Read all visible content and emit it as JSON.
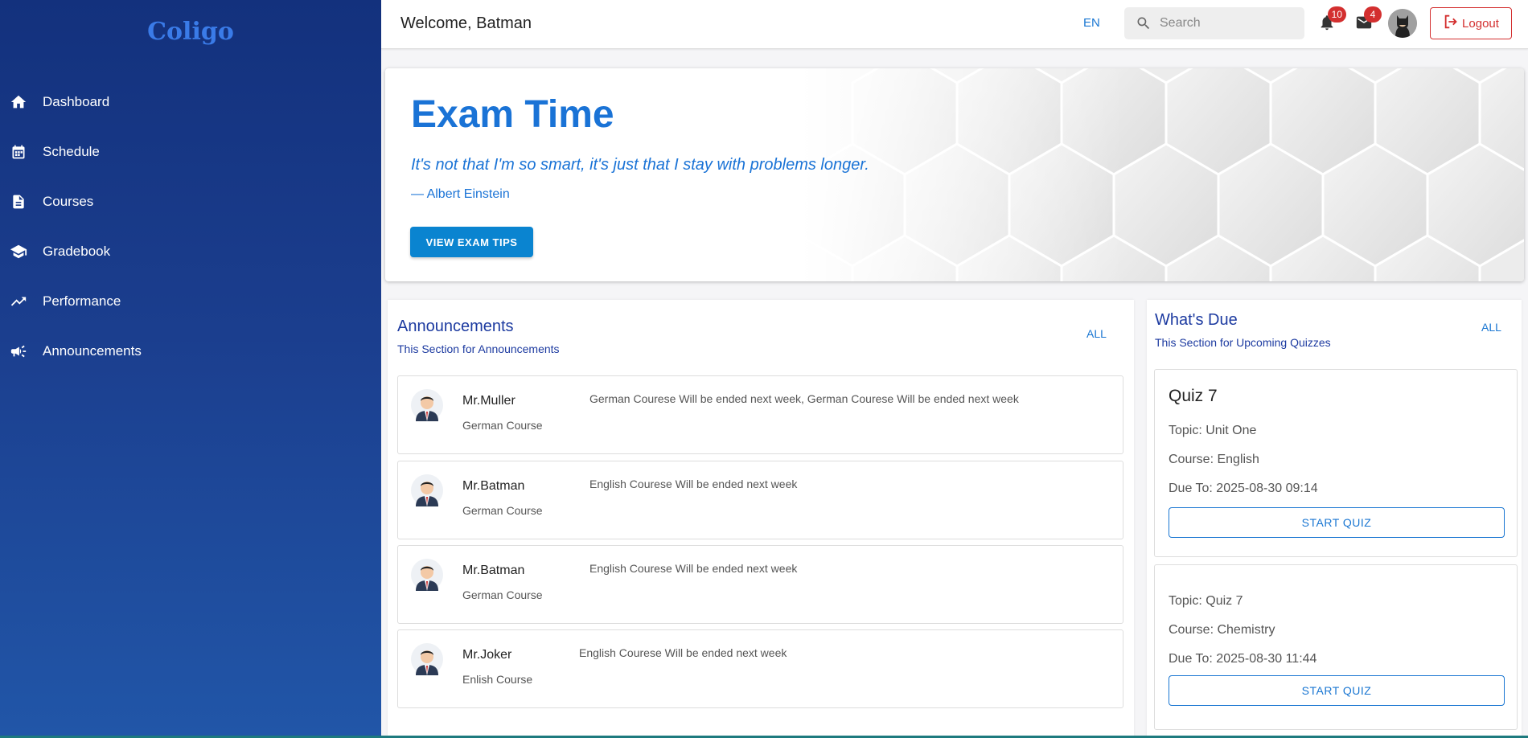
{
  "app": {
    "logo": "Coligo"
  },
  "sidebar": {
    "items": [
      {
        "label": "Dashboard",
        "icon": "home-icon"
      },
      {
        "label": "Schedule",
        "icon": "calendar-icon"
      },
      {
        "label": "Courses",
        "icon": "document-icon"
      },
      {
        "label": "Gradebook",
        "icon": "graduation-cap-icon"
      },
      {
        "label": "Performance",
        "icon": "trending-up-icon"
      },
      {
        "label": "Announcements",
        "icon": "megaphone-icon"
      }
    ]
  },
  "header": {
    "welcome": "Welcome, Batman",
    "language": "EN",
    "search_placeholder": "Search",
    "notifications_count": "10",
    "messages_count": "4",
    "logout_label": "Logout"
  },
  "hero": {
    "title": "Exam Time",
    "quote": "It's not that I'm so smart, it's just that I stay with problems longer.",
    "author": "— Albert Einstein",
    "button_label": "VIEW EXAM TIPS"
  },
  "announcements": {
    "title": "Announcements",
    "subtitle": "This Section for Announcements",
    "all_label": "ALL",
    "items": [
      {
        "name": "Mr.Muller",
        "course": "German Course",
        "message": "German Courese Will be ended next week, German Courese Will be ended next week"
      },
      {
        "name": "Mr.Batman",
        "course": "German Course",
        "message": "English Courese Will be ended next week"
      },
      {
        "name": "Mr.Batman",
        "course": "German Course",
        "message": "English Courese Will be ended next week"
      },
      {
        "name": "Mr.Joker",
        "course": "Enlish Course",
        "message": "English Courese Will be ended next week"
      }
    ]
  },
  "due": {
    "title": "What's Due",
    "subtitle": "This Section for Upcoming Quizzes",
    "all_label": "ALL",
    "quizzes": [
      {
        "title": "Quiz 7",
        "topic": "Topic: Unit One",
        "course": "Course: English",
        "due": "Due To: 2025-08-30 09:14",
        "button_label": "START QUIZ"
      },
      {
        "title": "",
        "topic": "Topic: Quiz 7",
        "course": "Course: Chemistry",
        "due": "Due To: 2025-08-30 11:44",
        "button_label": "START QUIZ"
      }
    ]
  }
}
